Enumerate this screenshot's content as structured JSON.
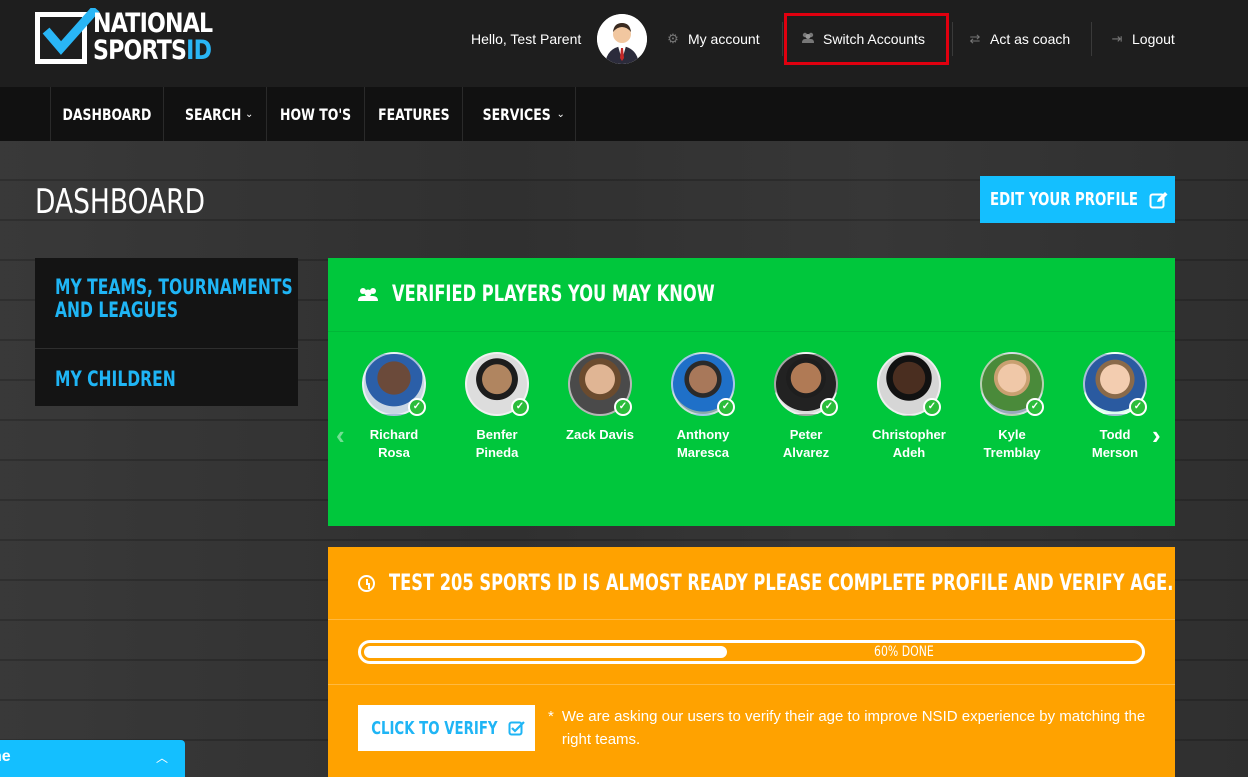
{
  "brand": {
    "logo_line1": "NATIONAL",
    "logo_line2a": "SPORTS",
    "logo_line2b": "ID"
  },
  "header": {
    "greeting": "Hello, Test Parent",
    "my_account": "My account",
    "switch_accounts": "Switch Accounts",
    "act_as_coach": "Act as coach",
    "logout": "Logout"
  },
  "nav": {
    "items": [
      {
        "label": "DASHBOARD",
        "dropdown": false
      },
      {
        "label": "SEARCH",
        "dropdown": true
      },
      {
        "label": "HOW TO'S",
        "dropdown": false
      },
      {
        "label": "FEATURES",
        "dropdown": false
      },
      {
        "label": "SERVICES",
        "dropdown": true
      }
    ]
  },
  "page": {
    "title": "DASHBOARD",
    "edit_profile": "EDIT YOUR PROFILE"
  },
  "sidebar": {
    "items": [
      {
        "line1": "MY TEAMS, TOURNAMENTS",
        "line2": "AND LEAGUES"
      },
      {
        "line1": "MY CHILDREN"
      }
    ]
  },
  "players_panel": {
    "title": "VERIFIED PLAYERS YOU MAY KNOW",
    "players": [
      {
        "first": "Richard",
        "last": "Rosa"
      },
      {
        "first": "Benfer",
        "last": "Pineda"
      },
      {
        "first": "Zack Davis",
        "last": ""
      },
      {
        "first": "Anthony",
        "last": "Maresca"
      },
      {
        "first": "Peter",
        "last": "Alvarez"
      },
      {
        "first": "Christopher",
        "last": "Adeh"
      },
      {
        "first": "Kyle",
        "last": "Tremblay"
      },
      {
        "first": "Todd",
        "last": "Merson"
      }
    ],
    "colors": {
      "panel": "#00c73c",
      "check": "#2bbd3b"
    }
  },
  "profile_panel": {
    "title": "TEST 205 SPORTS ID IS ALMOST READY PLEASE COMPLETE PROFILE AND VERIFY AGE.",
    "progress_percent": 60,
    "progress_label": "60% DONE",
    "verify_button": "CLICK TO VERIFY",
    "note_star": "*",
    "note": "We are asking our users to verify their age to improve NSID experience by matching the right teams.",
    "colors": {
      "panel": "#ffa200",
      "accent": "#14bfff"
    }
  },
  "chat": {
    "label": "ne"
  }
}
